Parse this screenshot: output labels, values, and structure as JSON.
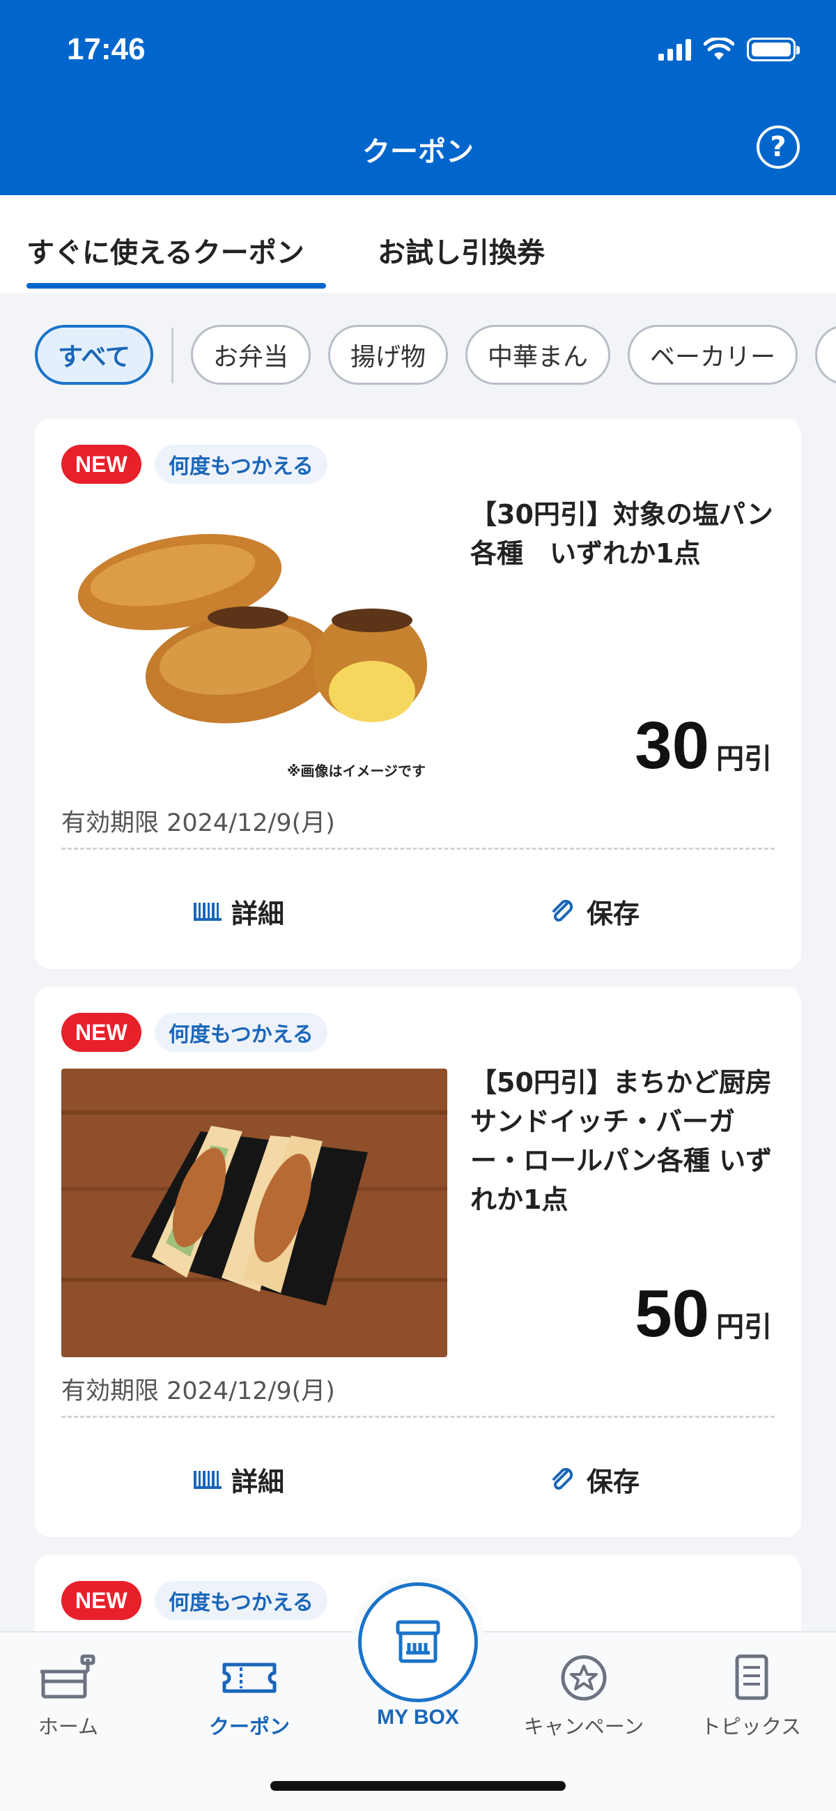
{
  "status_bar": {
    "time": "17:46"
  },
  "header": {
    "title": "クーポン",
    "help_label": "?"
  },
  "tabs": [
    {
      "label": "すぐに使えるクーポン",
      "active": true
    },
    {
      "label": "お試し引換券",
      "active": false
    }
  ],
  "chips": [
    {
      "label": "すべて",
      "active": true
    },
    {
      "label": "お弁当",
      "active": false
    },
    {
      "label": "揚げ物",
      "active": false
    },
    {
      "label": "中華まん",
      "active": false
    },
    {
      "label": "ベーカリー",
      "active": false
    }
  ],
  "coupons": [
    {
      "badge_new": "NEW",
      "badge_reuse": "何度もつかえる",
      "title": "【30円引】対象の塩パン各種　いずれか1点",
      "amount": "30",
      "unit": "円引",
      "image_caption": "※画像はイメージです",
      "expiry": "有効期限 2024/12/9(月)",
      "detail_label": "詳細",
      "save_label": "保存"
    },
    {
      "badge_new": "NEW",
      "badge_reuse": "何度もつかえる",
      "title": "【50円引】まちかど厨房 サンドイッチ・バーガー・ロールパン各種 いずれか1点",
      "amount": "50",
      "unit": "円引",
      "expiry": "有効期限 2024/12/9(月)",
      "detail_label": "詳細",
      "save_label": "保存"
    },
    {
      "badge_new": "NEW",
      "badge_reuse": "何度もつかえる"
    }
  ],
  "bottom_nav": {
    "home": "ホーム",
    "coupon": "クーポン",
    "mybox": "MY BOX",
    "campaign": "キャンペーン",
    "topics": "トピックス"
  },
  "colors": {
    "brand_blue": "#0066cc",
    "new_red": "#e8202a"
  }
}
